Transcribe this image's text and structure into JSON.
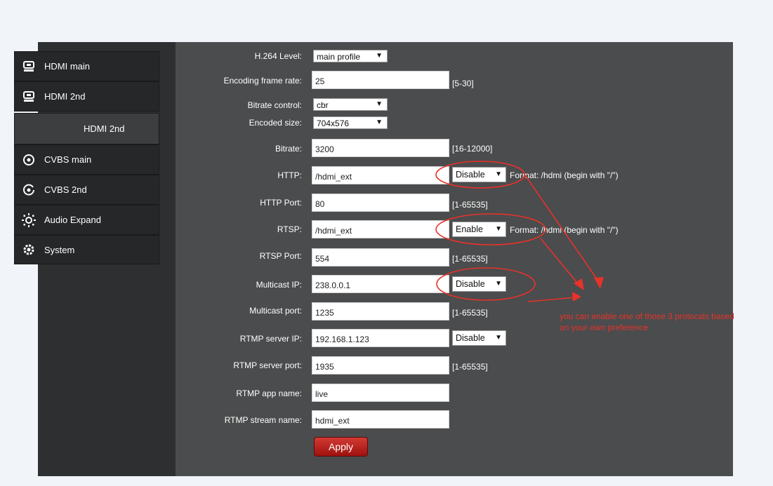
{
  "sidebar": {
    "items": [
      {
        "label": "HDMI main",
        "icon": "monitor-icon"
      },
      {
        "label": "HDMI 2nd",
        "icon": "monitor-icon"
      },
      {
        "label": "HDMI 2nd",
        "icon": ""
      },
      {
        "label": "CVBS main",
        "icon": "target-icon"
      },
      {
        "label": "CVBS 2nd",
        "icon": "target-icon"
      },
      {
        "label": "Audio Expand",
        "icon": "dotted-circle-icon"
      },
      {
        "label": "System",
        "icon": "gear-icon"
      }
    ]
  },
  "form": {
    "h264_level": {
      "label": "H.264 Level:",
      "value": "main profile"
    },
    "frame_rate": {
      "label": "Encoding frame rate:",
      "value": "25",
      "hint": "[5-30]"
    },
    "bitrate_control": {
      "label": "Bitrate control:",
      "value": "cbr"
    },
    "encoded_size": {
      "label": "Encoded size:",
      "value": "704x576"
    },
    "bitrate": {
      "label": "Bitrate:",
      "value": "3200",
      "hint": "[16-12000]"
    },
    "http": {
      "label": "HTTP:",
      "value": "/hdmi_ext",
      "toggle": "Disable",
      "hint": "Format: /hdmi (begin with \"/\")"
    },
    "http_port": {
      "label": "HTTP Port:",
      "value": "80",
      "hint": "[1-65535]"
    },
    "rtsp": {
      "label": "RTSP:",
      "value": "/hdmi_ext",
      "toggle": "Enable",
      "hint": "Format: /hdmi (begin with \"/\")"
    },
    "rtsp_port": {
      "label": "RTSP Port:",
      "value": "554",
      "hint": "[1-65535]"
    },
    "multicast_ip": {
      "label": "Multicast IP:",
      "value": "238.0.0.1",
      "toggle": "Disable"
    },
    "multicast_port": {
      "label": "Multicast port:",
      "value": "1235",
      "hint": "[1-65535]"
    },
    "rtmp_server_ip": {
      "label": "RTMP server IP:",
      "value": "192.168.1.123",
      "toggle": "Disable"
    },
    "rtmp_server_port": {
      "label": "RTMP server port:",
      "value": "1935",
      "hint": "[1-65535]"
    },
    "rtmp_app_name": {
      "label": "RTMP app name:",
      "value": "live"
    },
    "rtmp_stream_name": {
      "label": "RTMP stream name:",
      "value": "hdmi_ext"
    },
    "apply_label": "Apply"
  },
  "annotation": {
    "line1": "you can enable one of those 3 protocals based",
    "line2": "on your own preference",
    "color": "#e8322a"
  },
  "colors": {
    "sidebar_bg": "#2e2f31",
    "content_bg": "#4b4c4d",
    "apply_button": "#c0201b"
  }
}
